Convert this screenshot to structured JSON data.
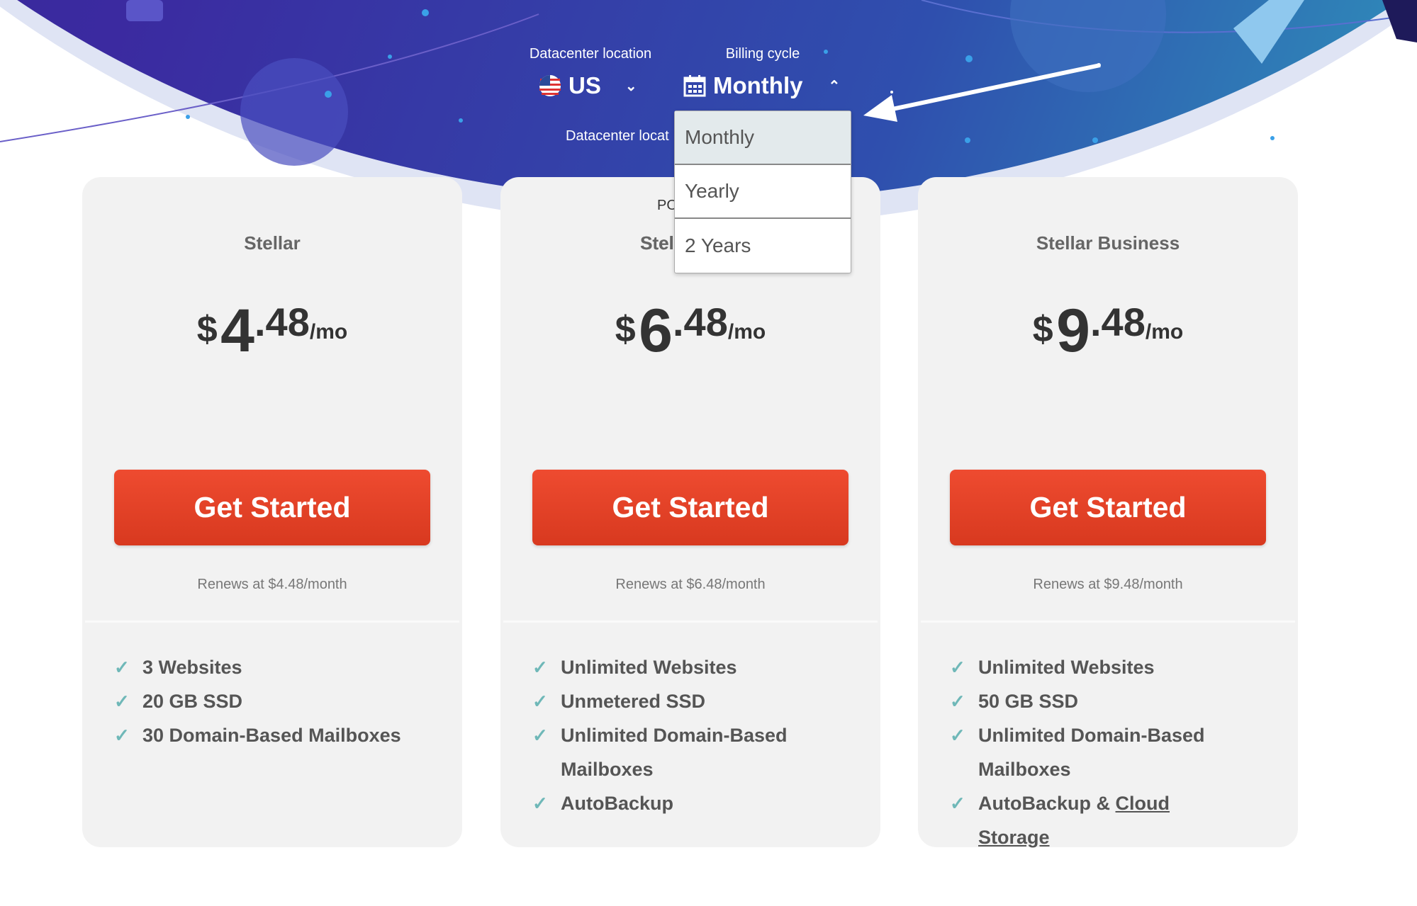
{
  "header": {
    "datacenter_label": "Datacenter location",
    "datacenter_value": "US",
    "billing_label": "Billing cycle",
    "billing_value": "Monthly",
    "datacenter_label_partial": "Datacenter locat",
    "card_label_partial": "PO",
    "plan_name_partial": "Stel"
  },
  "billing_dropdown": {
    "options": [
      "Monthly",
      "Yearly",
      "2 Years"
    ],
    "selected": "Monthly"
  },
  "plans": [
    {
      "name": "Stellar",
      "currency": "$",
      "int": "4",
      "dec": ".48",
      "per": "/mo",
      "button": "Get Started",
      "renew": "Renews at $4.48/month",
      "features": [
        "3 Websites",
        "20 GB SSD",
        "30 Domain-Based Mailboxes"
      ]
    },
    {
      "name": "Stellar Plus",
      "currency": "$",
      "int": "6",
      "dec": ".48",
      "per": "/mo",
      "button": "Get Started",
      "renew": "Renews at $6.48/month",
      "features": [
        "Unlimited Websites",
        "Unmetered SSD",
        "Unlimited Domain-Based Mailboxes",
        "AutoBackup"
      ]
    },
    {
      "name": "Stellar Business",
      "currency": "$",
      "int": "9",
      "dec": ".48",
      "per": "/mo",
      "button": "Get Started",
      "renew": "Renews at $9.48/month",
      "features": [
        "Unlimited Websites",
        "50 GB SSD",
        "Unlimited Domain-Based Mailboxes"
      ],
      "last_feature": {
        "text": "AutoBackup & ",
        "link": "Cloud Storage"
      }
    }
  ],
  "colors": {
    "button": "#e2442a",
    "check": "#6fb8b8",
    "hero_start": "#3b2a9c",
    "hero_end": "#2f7fb8"
  }
}
